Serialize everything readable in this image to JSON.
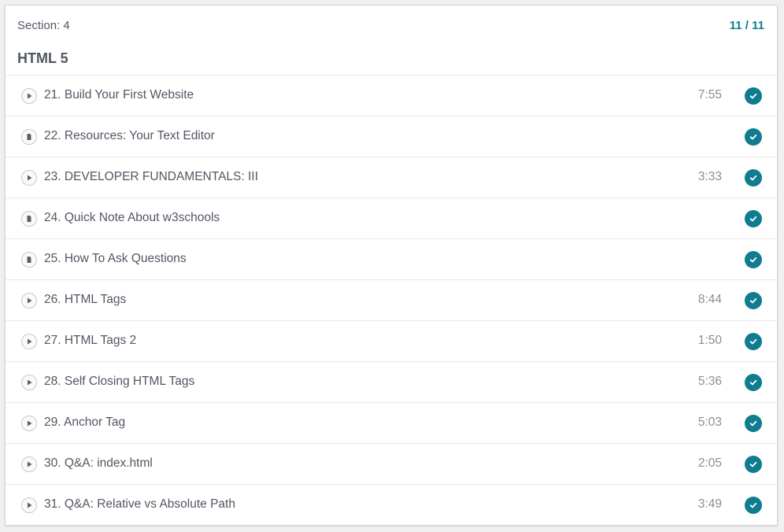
{
  "section": {
    "label": "Section: 4",
    "progress": "11 / 11",
    "title": "HTML 5"
  },
  "colors": {
    "accent": "#0f7c90",
    "text": "#505763",
    "muted": "#8a8f95"
  },
  "lectures": [
    {
      "title": "21. Build Your First Website",
      "type": "video",
      "duration": "7:55",
      "completed": true
    },
    {
      "title": "22. Resources: Your Text Editor",
      "type": "article",
      "duration": "",
      "completed": true
    },
    {
      "title": "23. DEVELOPER FUNDAMENTALS: III",
      "type": "video",
      "duration": "3:33",
      "completed": true
    },
    {
      "title": "24. Quick Note About w3schools",
      "type": "article",
      "duration": "",
      "completed": true
    },
    {
      "title": "25. How To Ask Questions",
      "type": "article",
      "duration": "",
      "completed": true
    },
    {
      "title": "26. HTML Tags",
      "type": "video",
      "duration": "8:44",
      "completed": true
    },
    {
      "title": "27. HTML Tags 2",
      "type": "video",
      "duration": "1:50",
      "completed": true
    },
    {
      "title": "28. Self Closing HTML Tags",
      "type": "video",
      "duration": "5:36",
      "completed": true
    },
    {
      "title": "29. Anchor Tag",
      "type": "video",
      "duration": "5:03",
      "completed": true
    },
    {
      "title": "30. Q&A: index.html",
      "type": "video",
      "duration": "2:05",
      "completed": true
    },
    {
      "title": "31. Q&A: Relative vs Absolute Path",
      "type": "video",
      "duration": "3:49",
      "completed": true
    }
  ]
}
